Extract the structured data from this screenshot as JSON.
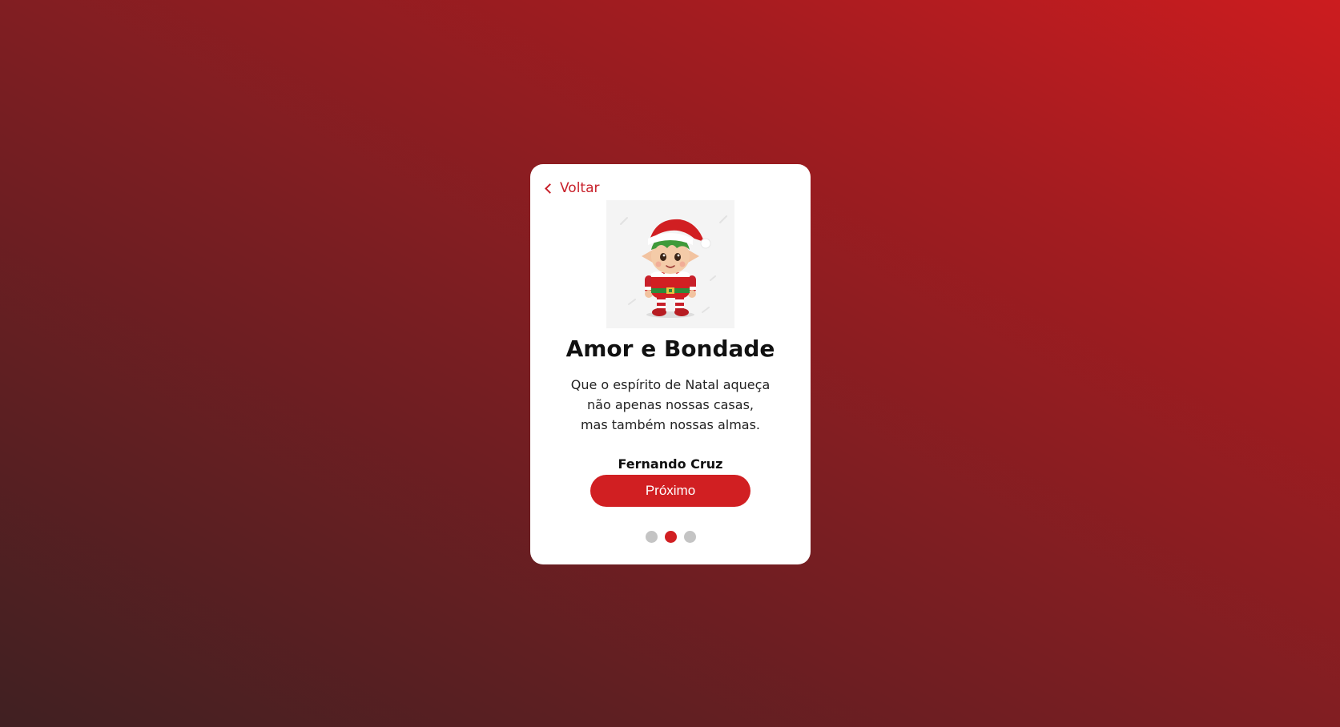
{
  "card": {
    "back_label": "Voltar",
    "title": "Amor e Bondade",
    "message_lines": [
      "Que o espírito de Natal aqueça",
      "não apenas nossas casas,",
      "mas também nossas almas."
    ],
    "author": "Fernando Cruz",
    "next_label": "Próximo",
    "illustration_icon": "christmas-elf-illustration",
    "back_icon": "chevron-left-icon"
  },
  "pagination": {
    "total": 3,
    "active_index": 1
  },
  "colors": {
    "accent": "#d11f22",
    "background_dark": "#402022",
    "background_light": "#cc1c1f",
    "dot_inactive": "#c4c4c4"
  }
}
